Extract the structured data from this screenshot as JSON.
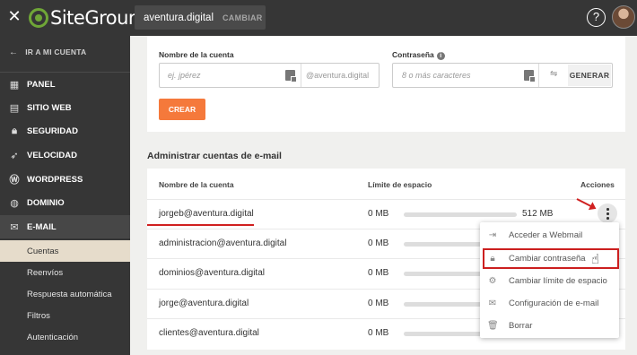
{
  "topbar": {
    "logo_text": "SiteGround",
    "domain": "aventura.digital",
    "change_label": "CAMBIAR",
    "help_label": "?"
  },
  "sidebar": {
    "back_label": "IR A MI CUENTA",
    "items": [
      {
        "label": "PANEL",
        "icon": "grid-icon"
      },
      {
        "label": "SITIO WEB",
        "icon": "website-icon"
      },
      {
        "label": "SEGURIDAD",
        "icon": "lock-icon"
      },
      {
        "label": "VELOCIDAD",
        "icon": "speed-icon"
      },
      {
        "label": "WORDPRESS",
        "icon": "wordpress-icon"
      },
      {
        "label": "DOMINIO",
        "icon": "globe-icon"
      },
      {
        "label": "E-MAIL",
        "icon": "mail-icon"
      }
    ],
    "subitems": [
      {
        "label": "Cuentas"
      },
      {
        "label": "Reenvíos"
      },
      {
        "label": "Respuesta automática"
      },
      {
        "label": "Filtros"
      },
      {
        "label": "Autenticación"
      }
    ]
  },
  "create_form": {
    "account_label": "Nombre de la cuenta",
    "account_placeholder": "ej. jpérez",
    "account_domain": "@aventura.digital",
    "password_label": "Contraseña",
    "password_placeholder": "8 o más caracteres",
    "generate_label": "GENERAR",
    "create_label": "CREAR"
  },
  "manage": {
    "title": "Administrar cuentas de e-mail",
    "headers": {
      "account": "Nombre de la cuenta",
      "limit": "Límite de espacio",
      "actions": "Acciones"
    },
    "rows": [
      {
        "email": "jorgeb@aventura.digital",
        "used": "0 MB",
        "limit": "512 MB",
        "used_fraction": 0
      },
      {
        "email": "administracion@aventura.digital",
        "used": "0 MB",
        "limit": "",
        "used_fraction": 0
      },
      {
        "email": "dominios@aventura.digital",
        "used": "0 MB",
        "limit": "",
        "used_fraction": 0
      },
      {
        "email": "jorge@aventura.digital",
        "used": "0 MB",
        "limit": "",
        "used_fraction": 0
      },
      {
        "email": "clientes@aventura.digital",
        "used": "0 MB",
        "limit": "",
        "used_fraction": 0
      }
    ]
  },
  "actions_menu": {
    "items": [
      {
        "label": "Acceder a Webmail",
        "icon": "login-icon"
      },
      {
        "label": "Cambiar contraseña",
        "icon": "lock-icon"
      },
      {
        "label": "Cambiar límite de espacio",
        "icon": "gauge-icon"
      },
      {
        "label": "Configuración de e-mail",
        "icon": "mail-settings-icon"
      },
      {
        "label": "Borrar",
        "icon": "trash-icon"
      }
    ]
  },
  "colors": {
    "topbar": "#363636",
    "accent": "#f5793b",
    "brand_green": "#6fa637",
    "highlight_red": "#cc1f1f",
    "active_sub": "#e6dccb"
  }
}
